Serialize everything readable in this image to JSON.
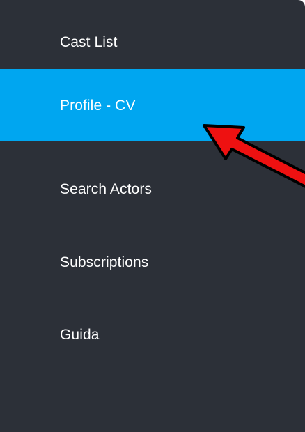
{
  "sidebar": {
    "colors": {
      "background": "#2c3038",
      "active_background": "#00a6f0",
      "text": "#ffffff"
    },
    "active_index": 1,
    "items": [
      {
        "label": "Cast List"
      },
      {
        "label": "Profile - CV"
      },
      {
        "label": "Search Actors"
      },
      {
        "label": "Subscriptions"
      },
      {
        "label": "Guida"
      }
    ]
  },
  "annotation": {
    "icon": "red-arrow-icon",
    "color": "#ee1111",
    "outline": "#000000",
    "points_to": "Profile - CV"
  }
}
